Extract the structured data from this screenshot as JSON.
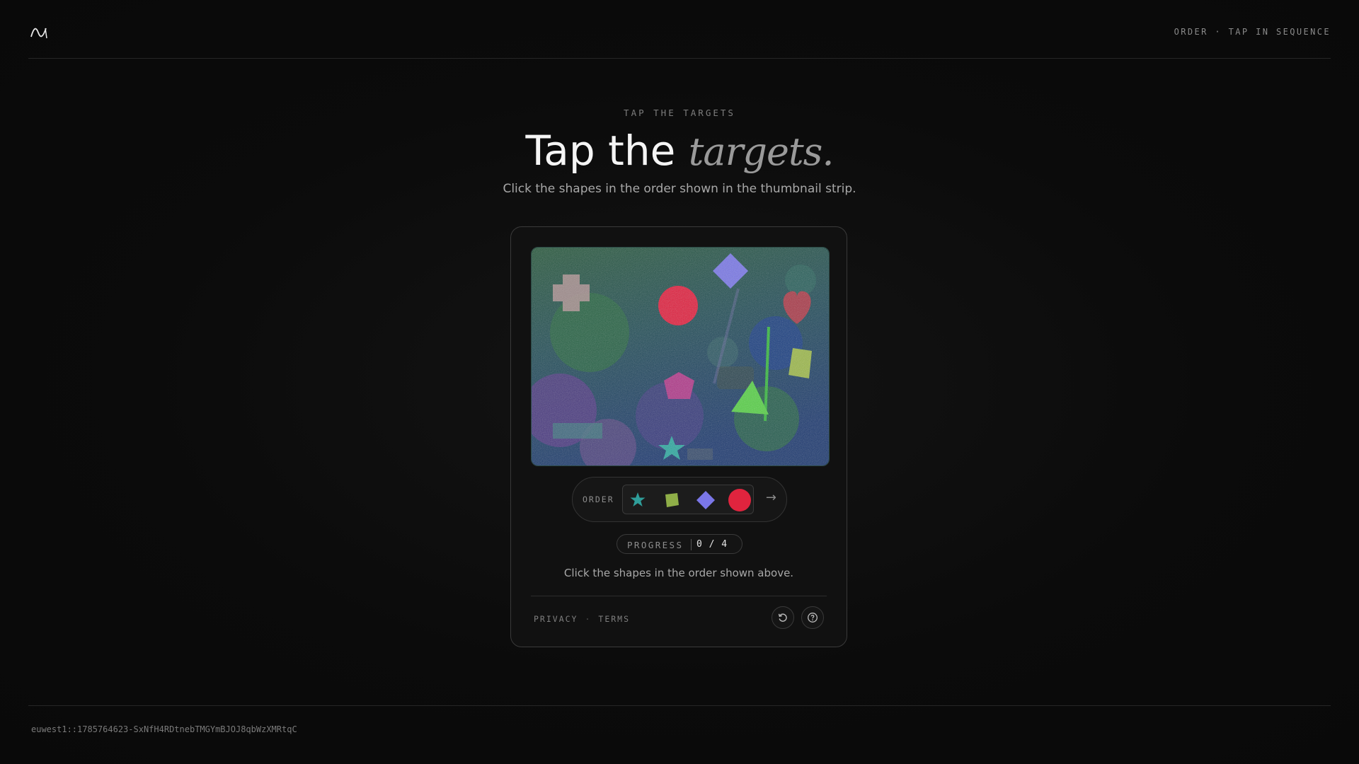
{
  "header": {
    "logo_icon": "wave-logo-icon",
    "mode_text": "ORDER · TAP IN SEQUENCE"
  },
  "hero": {
    "eyebrow": "TAP THE TARGETS",
    "title_plain": "Tap the",
    "title_emphasis": "targets.",
    "subtitle": "Click the shapes in the order shown in the thumbnail strip."
  },
  "challenge": {
    "canvas_shapes": [
      "cross",
      "red circle",
      "blue diamond",
      "red heart",
      "yellow square",
      "pink pentagon",
      "green triangle",
      "teal star"
    ],
    "order": {
      "label": "ORDER",
      "items": [
        {
          "shape": "star-icon",
          "color": "#2f9e9a"
        },
        {
          "shape": "square-icon",
          "color": "#8fae48"
        },
        {
          "shape": "diamond-icon",
          "color": "#7b77e8"
        },
        {
          "shape": "circle-icon",
          "color": "#e0243e"
        }
      ],
      "next_icon": "arrow-right-icon"
    },
    "progress": {
      "label": "PROGRESS",
      "current": 0,
      "total": 4,
      "text": "0 / 4"
    },
    "hint": "Click the shapes in the order shown above."
  },
  "card_footer": {
    "privacy": "PRIVACY",
    "separator": "·",
    "terms": "TERMS",
    "refresh_icon": "refresh-icon",
    "help_icon": "help-icon"
  },
  "footer": {
    "session_id": "euwest1::1785764623-SxNfH4RDtnebTMGYmBJOJ8qbWzXMRtqC"
  }
}
